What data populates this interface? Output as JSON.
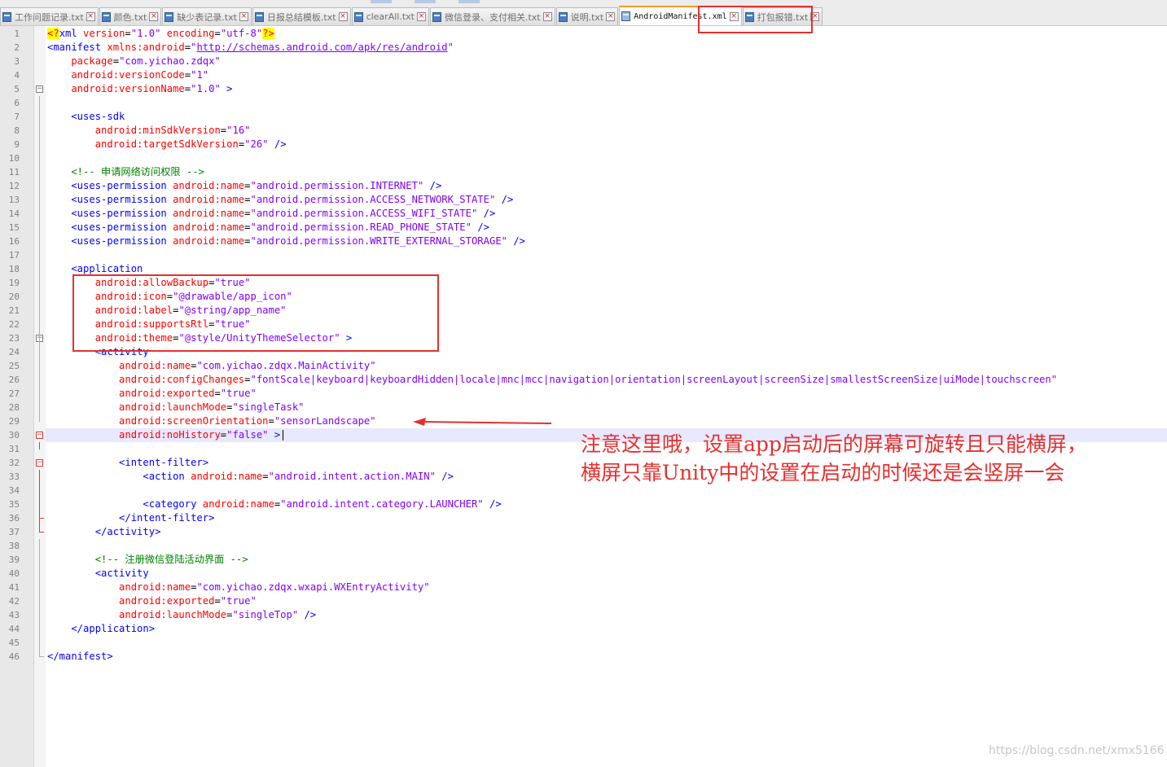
{
  "tabs": [
    {
      "label": "工作问题记录.txt",
      "active": false
    },
    {
      "label": "颜色.txt",
      "active": false
    },
    {
      "label": "缺少表记录.txt",
      "active": false
    },
    {
      "label": "日报总结模板.txt",
      "active": false
    },
    {
      "label": "clearAll.txt",
      "active": false
    },
    {
      "label": "微信登录、支付相关.txt",
      "active": false
    },
    {
      "label": "说明.txt",
      "active": false
    },
    {
      "label": "AndroidManifest.xml",
      "active": true
    },
    {
      "label": "打包报错.txt",
      "active": false
    }
  ],
  "icons": {
    "file": "file-icon",
    "close": "close-icon",
    "fold": "fold-toggle-icon"
  },
  "colors": {
    "tag": "#0000ff",
    "attribute": "#ff0000",
    "value": "#8000ff",
    "comment": "#008000",
    "annotation": "#e4302f",
    "current_line": "#e8e8ff"
  },
  "current_line": 30,
  "editor": {
    "lines": [
      [
        {
          "t": "<?",
          "c": "pi"
        },
        {
          "t": "xml",
          "c": "piname"
        },
        {
          "t": " version",
          "c": "attr"
        },
        {
          "t": "=",
          "c": ""
        },
        {
          "t": "\"1.0\"",
          "c": "val"
        },
        {
          "t": " encoding",
          "c": "attr"
        },
        {
          "t": "=",
          "c": ""
        },
        {
          "t": "\"utf-8\"",
          "c": "val"
        },
        {
          "t": "?>",
          "c": "pi"
        }
      ],
      [
        {
          "t": "<manifest",
          "c": "tag"
        },
        {
          "t": " xmlns:android",
          "c": "attr"
        },
        {
          "t": "=",
          "c": ""
        },
        {
          "t": "\"",
          "c": "val"
        },
        {
          "t": "http://schemas.android.com/apk/res/android",
          "c": "link"
        },
        {
          "t": "\"",
          "c": "val"
        }
      ],
      [
        {
          "t": "    package",
          "c": "attr"
        },
        {
          "t": "=",
          "c": ""
        },
        {
          "t": "\"com.yichao.zdqx\"",
          "c": "val"
        }
      ],
      [
        {
          "t": "    android:versionCode",
          "c": "attr"
        },
        {
          "t": "=",
          "c": ""
        },
        {
          "t": "\"1\"",
          "c": "val"
        }
      ],
      [
        {
          "t": "    android:versionName",
          "c": "attr"
        },
        {
          "t": "=",
          "c": ""
        },
        {
          "t": "\"1.0\"",
          "c": "val"
        },
        {
          "t": " >",
          "c": "tag"
        }
      ],
      [],
      [
        {
          "t": "    <uses-sdk",
          "c": "tag"
        }
      ],
      [
        {
          "t": "        android:minSdkVersion",
          "c": "attr"
        },
        {
          "t": "=",
          "c": ""
        },
        {
          "t": "\"16\"",
          "c": "val"
        }
      ],
      [
        {
          "t": "        android:targetSdkVersion",
          "c": "attr"
        },
        {
          "t": "=",
          "c": ""
        },
        {
          "t": "\"26\"",
          "c": "val"
        },
        {
          "t": " />",
          "c": "tag"
        }
      ],
      [],
      [
        {
          "t": "    <!-- 申请网络访问权限 -->",
          "c": "cmt"
        }
      ],
      [
        {
          "t": "    <uses-permission",
          "c": "tag"
        },
        {
          "t": " android:name",
          "c": "attr"
        },
        {
          "t": "=",
          "c": ""
        },
        {
          "t": "\"android.permission.INTERNET\"",
          "c": "val"
        },
        {
          "t": " />",
          "c": "tag"
        }
      ],
      [
        {
          "t": "    <uses-permission",
          "c": "tag"
        },
        {
          "t": " android:name",
          "c": "attr"
        },
        {
          "t": "=",
          "c": ""
        },
        {
          "t": "\"android.permission.ACCESS_NETWORK_STATE\"",
          "c": "val"
        },
        {
          "t": " />",
          "c": "tag"
        }
      ],
      [
        {
          "t": "    <uses-permission",
          "c": "tag"
        },
        {
          "t": " android:name",
          "c": "attr"
        },
        {
          "t": "=",
          "c": ""
        },
        {
          "t": "\"android.permission.ACCESS_WIFI_STATE\"",
          "c": "val"
        },
        {
          "t": " />",
          "c": "tag"
        }
      ],
      [
        {
          "t": "    <uses-permission",
          "c": "tag"
        },
        {
          "t": " android:name",
          "c": "attr"
        },
        {
          "t": "=",
          "c": ""
        },
        {
          "t": "\"android.permission.READ_PHONE_STATE\"",
          "c": "val"
        },
        {
          "t": " />",
          "c": "tag"
        }
      ],
      [
        {
          "t": "    <uses-permission",
          "c": "tag"
        },
        {
          "t": " android:name",
          "c": "attr"
        },
        {
          "t": "=",
          "c": ""
        },
        {
          "t": "\"android.permission.WRITE_EXTERNAL_STORAGE\"",
          "c": "val"
        },
        {
          "t": " />",
          "c": "tag"
        }
      ],
      [],
      [
        {
          "t": "    <application",
          "c": "tag"
        }
      ],
      [
        {
          "t": "        android:allowBackup",
          "c": "attr"
        },
        {
          "t": "=",
          "c": ""
        },
        {
          "t": "\"true\"",
          "c": "val"
        }
      ],
      [
        {
          "t": "        android:icon",
          "c": "attr"
        },
        {
          "t": "=",
          "c": ""
        },
        {
          "t": "\"@drawable/app_icon\"",
          "c": "val"
        }
      ],
      [
        {
          "t": "        android:label",
          "c": "attr"
        },
        {
          "t": "=",
          "c": ""
        },
        {
          "t": "\"@string/app_name\"",
          "c": "val"
        }
      ],
      [
        {
          "t": "        android:supportsRtl",
          "c": "attr"
        },
        {
          "t": "=",
          "c": ""
        },
        {
          "t": "\"true\"",
          "c": "val"
        }
      ],
      [
        {
          "t": "        android:theme",
          "c": "attr"
        },
        {
          "t": "=",
          "c": ""
        },
        {
          "t": "\"@style/UnityThemeSelector\"",
          "c": "val"
        },
        {
          "t": " >",
          "c": "tag"
        }
      ],
      [
        {
          "t": "        <activity",
          "c": "tag"
        }
      ],
      [
        {
          "t": "            android:name",
          "c": "attr"
        },
        {
          "t": "=",
          "c": ""
        },
        {
          "t": "\"com.yichao.zdqx.MainActivity\"",
          "c": "val"
        }
      ],
      [
        {
          "t": "            android:configChanges",
          "c": "attr"
        },
        {
          "t": "=",
          "c": ""
        },
        {
          "t": "\"fontScale|keyboard|keyboardHidden|locale|mnc|mcc|navigation|orientation|screenLayout|screenSize|smallestScreenSize|uiMode|touchscreen\"",
          "c": "val"
        }
      ],
      [
        {
          "t": "            android:exported",
          "c": "attr"
        },
        {
          "t": "=",
          "c": ""
        },
        {
          "t": "\"true\"",
          "c": "val"
        }
      ],
      [
        {
          "t": "            android:launchMode",
          "c": "attr"
        },
        {
          "t": "=",
          "c": ""
        },
        {
          "t": "\"singleTask\"",
          "c": "val"
        }
      ],
      [
        {
          "t": "            android:screenOrientation",
          "c": "attr"
        },
        {
          "t": "=",
          "c": ""
        },
        {
          "t": "\"sensorLandscape\"",
          "c": "val"
        }
      ],
      [
        {
          "t": "            android:noHistory",
          "c": "attr"
        },
        {
          "t": "=",
          "c": ""
        },
        {
          "t": "\"false\"",
          "c": "val"
        },
        {
          "t": " >",
          "c": "tag"
        }
      ],
      [],
      [
        {
          "t": "            <intent-filter>",
          "c": "tag"
        }
      ],
      [
        {
          "t": "                <action",
          "c": "tag"
        },
        {
          "t": " android:name",
          "c": "attr"
        },
        {
          "t": "=",
          "c": ""
        },
        {
          "t": "\"android.intent.action.MAIN\"",
          "c": "val"
        },
        {
          "t": " />",
          "c": "tag"
        }
      ],
      [],
      [
        {
          "t": "                <category",
          "c": "tag"
        },
        {
          "t": " android:name",
          "c": "attr"
        },
        {
          "t": "=",
          "c": ""
        },
        {
          "t": "\"android.intent.category.LAUNCHER\"",
          "c": "val"
        },
        {
          "t": " />",
          "c": "tag"
        }
      ],
      [
        {
          "t": "            </intent-filter>",
          "c": "tag"
        }
      ],
      [
        {
          "t": "        </activity>",
          "c": "tag"
        }
      ],
      [],
      [
        {
          "t": "        <!-- 注册微信登陆活动界面 -->",
          "c": "cmt"
        }
      ],
      [
        {
          "t": "        <activity",
          "c": "tag"
        }
      ],
      [
        {
          "t": "            android:name",
          "c": "attr"
        },
        {
          "t": "=",
          "c": ""
        },
        {
          "t": "\"com.yichao.zdqx.wxapi.WXEntryActivity\"",
          "c": "val"
        }
      ],
      [
        {
          "t": "            android:exported",
          "c": "attr"
        },
        {
          "t": "=",
          "c": ""
        },
        {
          "t": "\"true\"",
          "c": "val"
        }
      ],
      [
        {
          "t": "            android:launchMode",
          "c": "attr"
        },
        {
          "t": "=",
          "c": ""
        },
        {
          "t": "\"singleTop\"",
          "c": "val"
        },
        {
          "t": " />",
          "c": "tag"
        }
      ],
      [
        {
          "t": "    </application>",
          "c": "tag"
        }
      ],
      [],
      [
        {
          "t": "</manifest>",
          "c": "tag"
        }
      ]
    ]
  },
  "annotation": {
    "line1": "注意这里哦，设置app启动后的屏幕可旋转且只能横屏，",
    "line2": "横屏只靠Unity中的设置在启动的时候还是会竖屏一会"
  },
  "watermark": "https://blog.csdn.net/xmx5166"
}
